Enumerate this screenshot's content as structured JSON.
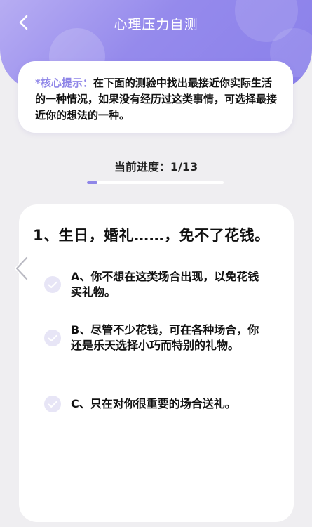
{
  "header": {
    "title": "心理压力自测",
    "gradient_colors": [
      "#b7adf3",
      "#8a80ea"
    ]
  },
  "tip": {
    "label": "*核心提示：",
    "text": "在下面的测验中找出最接近你实际生活的一种情况，如果没有经历过这类事情，可选择最接近你的想法的一种。"
  },
  "progress": {
    "label": "当前进度：1/13",
    "current": 1,
    "total": 13,
    "fraction": 0.0769
  },
  "question": {
    "text": "1、生日，婚礼……，免不了花钱。",
    "options": [
      {
        "label": "A、你不想在这类场合出现，以免花钱买礼物。"
      },
      {
        "label": "B、尽管不少花钱，可在各种场合，你还是乐天选择小巧而特别的礼物。"
      },
      {
        "label": "C、只在对你很重要的场合送礼。"
      }
    ]
  },
  "icons": {
    "back": "chevron-left-icon",
    "prev": "chevron-left-icon",
    "option_mark": "check-icon"
  },
  "colors": {
    "accent": "#8f86e8",
    "check_bg": "#e7e5f6",
    "page_bg": "#efeef1"
  }
}
